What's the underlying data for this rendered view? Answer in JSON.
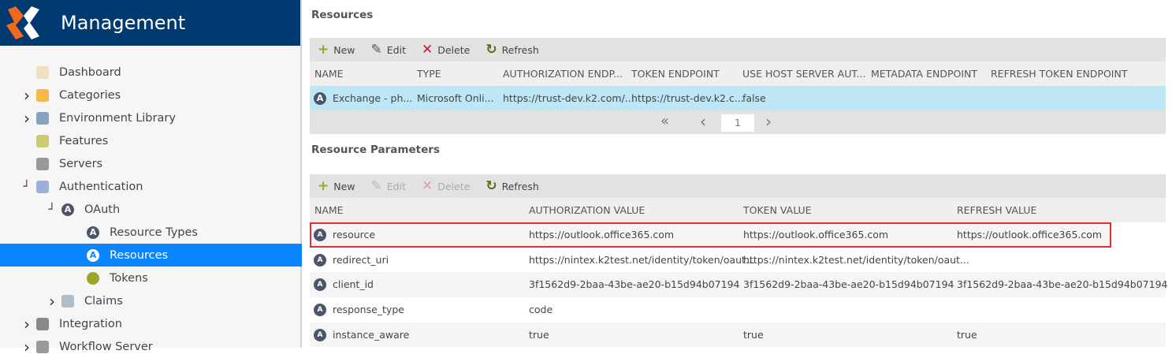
{
  "app": {
    "title": "Management"
  },
  "sidebar": {
    "items": [
      {
        "label": "Dashboard",
        "icon": "dashboard-icon",
        "level": 0,
        "expander": ""
      },
      {
        "label": "Categories",
        "icon": "folder-icon",
        "level": 0,
        "expander": "collapsed"
      },
      {
        "label": "Environment Library",
        "icon": "library-icon",
        "level": 0,
        "expander": "collapsed"
      },
      {
        "label": "Features",
        "icon": "features-icon",
        "level": 0,
        "expander": ""
      },
      {
        "label": "Servers",
        "icon": "server-icon",
        "level": 0,
        "expander": ""
      },
      {
        "label": "Authentication",
        "icon": "key-icon",
        "level": 0,
        "expander": "expanded"
      },
      {
        "label": "OAuth",
        "icon": "oauth-icon",
        "level": 1,
        "expander": "expanded"
      },
      {
        "label": "Resource Types",
        "icon": "oauth-icon",
        "level": 2,
        "expander": ""
      },
      {
        "label": "Resources",
        "icon": "resource-icon",
        "level": 2,
        "expander": "",
        "selected": true
      },
      {
        "label": "Tokens",
        "icon": "token-icon",
        "level": 2,
        "expander": ""
      },
      {
        "label": "Claims",
        "icon": "claims-icon",
        "level": 1,
        "expander": "collapsed"
      },
      {
        "label": "Integration",
        "icon": "puzzle-icon",
        "level": 0,
        "expander": "collapsed"
      },
      {
        "label": "Workflow Server",
        "icon": "server-icon",
        "level": 0,
        "expander": "collapsed"
      }
    ]
  },
  "resources": {
    "title": "Resources",
    "toolbar": {
      "new": "New",
      "edit": "Edit",
      "delete": "Delete",
      "refresh": "Refresh"
    },
    "columns": [
      "NAME",
      "TYPE",
      "AUTHORIZATION ENDP...",
      "TOKEN ENDPOINT",
      "USE HOST SERVER AUT...",
      "METADATA ENDPOINT",
      "REFRESH TOKEN ENDPOINT"
    ],
    "rows": [
      [
        "Exchange - ph...",
        "Microsoft Onli...",
        "https://trust-dev.k2.com/...",
        "https://trust-dev.k2.c...",
        "false",
        "",
        ""
      ]
    ],
    "pager": {
      "first": "«",
      "prev": "‹",
      "page": "1",
      "next": "›"
    }
  },
  "parameters": {
    "title": "Resource Parameters",
    "toolbar": {
      "new": "New",
      "edit": "Edit",
      "delete": "Delete",
      "refresh": "Refresh"
    },
    "columns": [
      "NAME",
      "AUTHORIZATION VALUE",
      "TOKEN VALUE",
      "REFRESH VALUE"
    ],
    "rows": [
      [
        "resource",
        "https://outlook.office365.com",
        "https://outlook.office365.com",
        "https://outlook.office365.com"
      ],
      [
        "redirect_uri",
        "https://nintex.k2test.net/identity/token/oaut...",
        "https://nintex.k2test.net/identity/token/oaut...",
        ""
      ],
      [
        "client_id",
        "3f1562d9-2baa-43be-ae20-b15d94b07194",
        "3f1562d9-2baa-43be-ae20-b15d94b07194",
        "3f1562d9-2baa-43be-ae20-b15d94b07194"
      ],
      [
        "response_type",
        "code",
        "",
        ""
      ],
      [
        "instance_aware",
        "true",
        "true",
        "true"
      ]
    ]
  },
  "colors": {
    "header": "#003a70",
    "selected": "#0a84ff",
    "rowSelected": "#bde6f7",
    "highlight": "#e03030"
  }
}
